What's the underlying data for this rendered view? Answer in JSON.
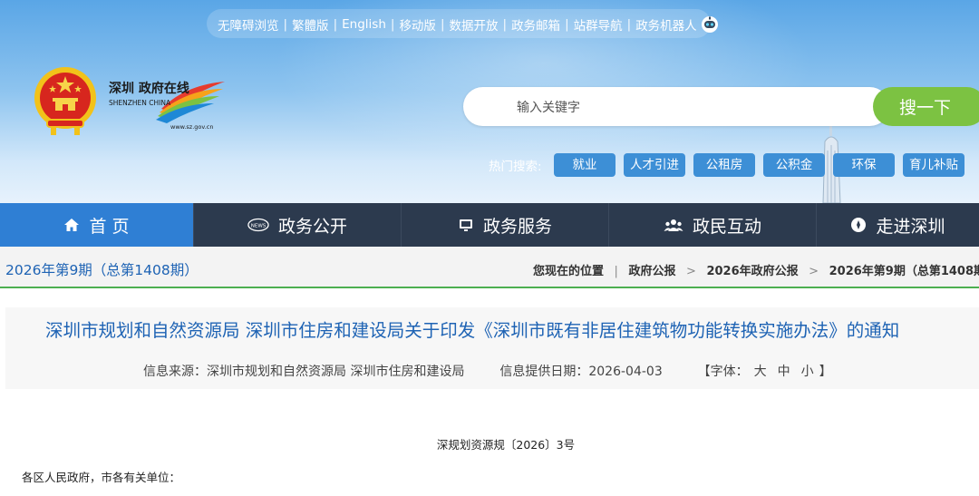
{
  "topbar": {
    "links": [
      "无障碍浏览",
      "繁體版",
      "English",
      "移动版",
      "数据开放",
      "政务邮箱",
      "站群导航",
      "政务机器人"
    ],
    "robot_icon": "robot-icon"
  },
  "logo": {
    "cn_text": "深圳 政府在线",
    "en_text": "SHENZHEN CHINA",
    "domain": "www.sz.gov.cn"
  },
  "search": {
    "placeholder": "输入关键字",
    "button_label": "搜一下"
  },
  "hot_search": {
    "label": "热门搜索:",
    "tags": [
      "就业",
      "人才引进",
      "公租房",
      "公积金",
      "环保",
      "育儿补贴"
    ]
  },
  "nav": {
    "items": [
      {
        "label": "首 页",
        "icon": "home-icon"
      },
      {
        "label": "政务公开",
        "icon": "news-icon"
      },
      {
        "label": "政务服务",
        "icon": "monitor-icon"
      },
      {
        "label": "政民互动",
        "icon": "people-icon"
      },
      {
        "label": "走进深圳",
        "icon": "compass-icon"
      }
    ]
  },
  "issue": {
    "title": "2026年第9期（总第1408期）"
  },
  "breadcrumb": {
    "location_label": "您现在的位置",
    "items": [
      "政府公报",
      "2026年政府公报",
      "2026年第9期（总第1408期"
    ]
  },
  "article": {
    "title": "深圳市规划和自然资源局 深圳市住房和建设局关于印发《深圳市既有非居住建筑物功能转换实施办法》的通知",
    "source_label": "信息来源：",
    "source": "深圳市规划和自然资源局 深圳市住房和建设局",
    "date_label": "信息提供日期：",
    "date": "2026-04-03",
    "font_label_open": "【字体：",
    "font_large": "大",
    "font_medium": "中",
    "font_small": "小",
    "font_label_close": "】",
    "doc_number": "深规划资源规〔2026〕3号",
    "salutation": "各区人民政府，市各有关单位："
  },
  "colors": {
    "nav_bg": "#2c3a4e",
    "nav_active": "#2f7fd4",
    "accent_green": "#7cc242",
    "link_blue": "#1e63b4"
  }
}
